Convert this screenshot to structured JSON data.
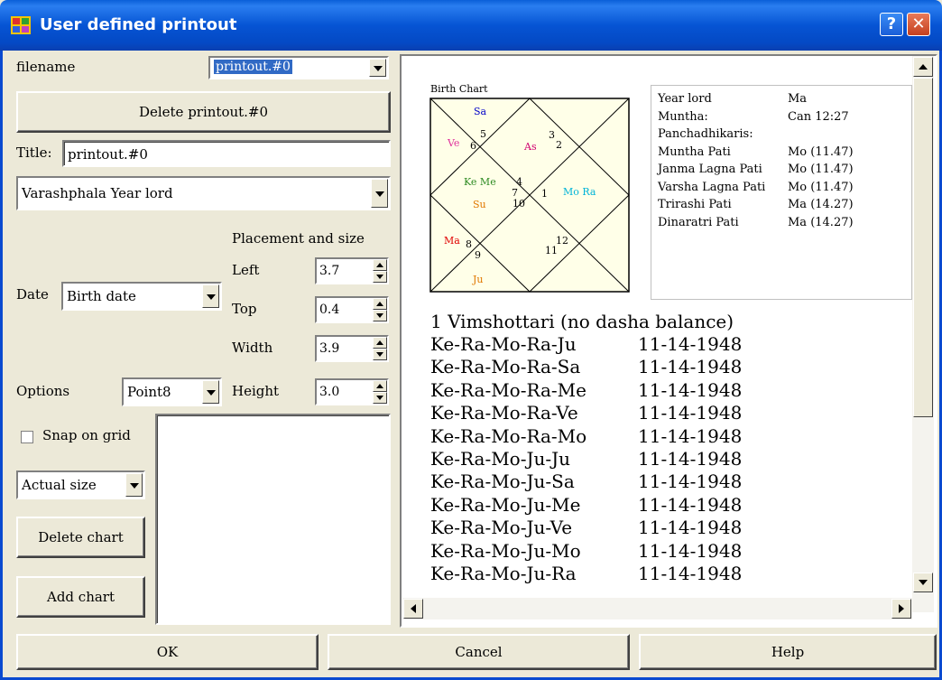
{
  "window": {
    "title": "User defined printout",
    "help_label": "?",
    "close_label": "✕"
  },
  "left": {
    "filename_label": "filename",
    "filename_value": "printout.#0",
    "delete_printout_label": "Delete printout.#0",
    "title_label": "Title:",
    "title_value": "printout.#0",
    "content_select_value": "Varashphala Year lord",
    "placement_label": "Placement and size",
    "date_label": "Date",
    "date_value": "Birth date",
    "left_label": "Left",
    "left_value": "3.7",
    "top_label": "Top",
    "top_value": "0.4",
    "width_label": "Width",
    "width_value": "3.9",
    "height_label": "Height",
    "height_value": "3.0",
    "options_label": "Options",
    "options_value": "Point8",
    "snap_label": "Snap on grid",
    "snap_checked": false,
    "size_value": "Actual size",
    "delete_chart_label": "Delete chart",
    "add_chart_label": "Add chart"
  },
  "preview": {
    "chart_title": "Birth Chart",
    "houses": [
      "1",
      "2",
      "3",
      "4",
      "5",
      "6",
      "7",
      "8",
      "9",
      "10",
      "11",
      "12"
    ],
    "planets": [
      {
        "label": "Sa",
        "color": "#0000c8"
      },
      {
        "label": "Ve",
        "color": "#e0309c"
      },
      {
        "label": "As",
        "color": "#d00070"
      },
      {
        "label": "Ke Me",
        "color": "#2e8b22"
      },
      {
        "label": "Su",
        "color": "#e07800"
      },
      {
        "label": "Mo Ra",
        "color": "#00b4d8"
      },
      {
        "label": "Ma",
        "color": "#e00000"
      },
      {
        "label": "Ju",
        "color": "#e07800"
      }
    ],
    "info": [
      {
        "label": "Year lord",
        "value": "Ma"
      },
      {
        "label": "Muntha:",
        "value": "Can 12:27"
      },
      {
        "label": "Panchadhikaris:",
        "value": ""
      },
      {
        "label": "Muntha Pati",
        "value": "Mo (11.47)"
      },
      {
        "label": "Janma Lagna Pati",
        "value": "Mo (11.47)"
      },
      {
        "label": "Varsha Lagna Pati",
        "value": "Mo (11.47)"
      },
      {
        "label": "Trirashi Pati",
        "value": "Ma (14.27)"
      },
      {
        "label": "Dinaratri Pati",
        "value": "Ma (14.27)"
      }
    ],
    "dasha_heading": "1 Vimshottari (no dasha balance)",
    "dasha_rows": [
      {
        "period": "Ke-Ra-Mo-Ra-Ju",
        "date": "11-14-1948"
      },
      {
        "period": "Ke-Ra-Mo-Ra-Sa",
        "date": "11-14-1948"
      },
      {
        "period": "Ke-Ra-Mo-Ra-Me",
        "date": "11-14-1948"
      },
      {
        "period": "Ke-Ra-Mo-Ra-Ve",
        "date": "11-14-1948"
      },
      {
        "period": "Ke-Ra-Mo-Ra-Mo",
        "date": "11-14-1948"
      },
      {
        "period": "Ke-Ra-Mo-Ju-Ju",
        "date": "11-14-1948"
      },
      {
        "period": "Ke-Ra-Mo-Ju-Sa",
        "date": "11-14-1948"
      },
      {
        "period": "Ke-Ra-Mo-Ju-Me",
        "date": "11-14-1948"
      },
      {
        "period": "Ke-Ra-Mo-Ju-Ve",
        "date": "11-14-1948"
      },
      {
        "period": "Ke-Ra-Mo-Ju-Mo",
        "date": "11-14-1948"
      },
      {
        "period": "Ke-Ra-Mo-Ju-Ra",
        "date": "11-14-1948"
      }
    ]
  },
  "footer": {
    "ok_label": "OK",
    "cancel_label": "Cancel",
    "help_label": "Help"
  }
}
